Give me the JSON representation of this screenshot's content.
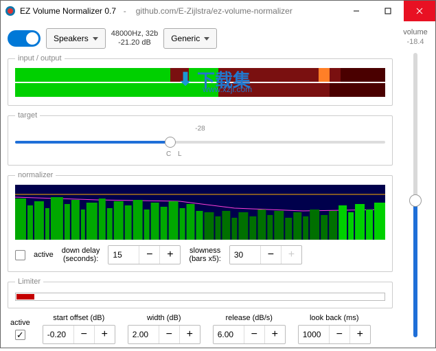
{
  "titlebar": {
    "app": "EZ Volume Normalizer 0.7",
    "link": "github.com/E-Zijlstra/ez-volume-normalizer"
  },
  "top": {
    "device": "Speakers",
    "sample": "48000Hz, 32b",
    "db": "-21.20 dB",
    "preset": "Generic"
  },
  "io": {
    "legend": "input / output"
  },
  "target": {
    "legend": "target",
    "value": "-28",
    "tick_c": "C",
    "tick_l": "L"
  },
  "normalizer": {
    "legend": "normalizer",
    "active_label": "active",
    "downdelay_label1": "down delay",
    "downdelay_label2": "(seconds):",
    "downdelay_value": "15",
    "slowness_label1": "slowness",
    "slowness_label2": "(bars x5):",
    "slowness_value": "30"
  },
  "limiter": {
    "legend": "Limiter",
    "active_label": "active",
    "start_label": "start offset (dB)",
    "start_value": "-0.20",
    "width_label": "width (dB)",
    "width_value": "2.00",
    "release_label": "release (dB/s)",
    "release_value": "6.00",
    "lookback_label": "look back (ms)",
    "lookback_value": "1000"
  },
  "volume": {
    "label": "volume",
    "value": "-18.4"
  },
  "watermark": {
    "text": "下载集",
    "url": "www.xzji.com"
  }
}
